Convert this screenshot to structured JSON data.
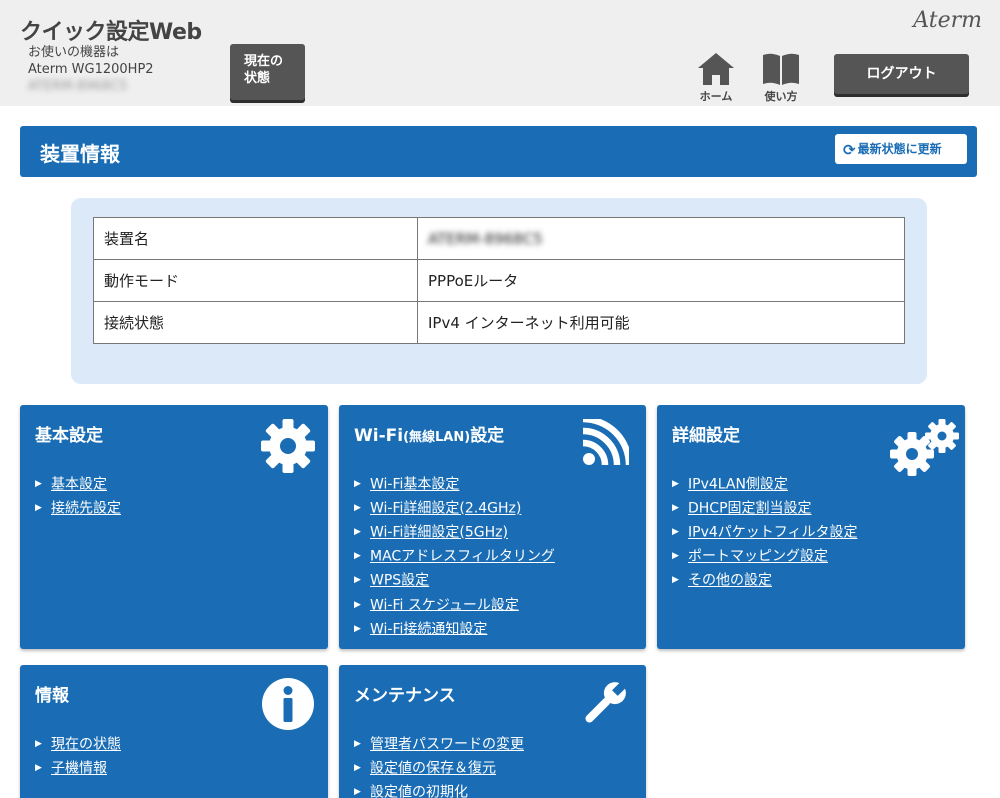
{
  "header": {
    "app_title": "クイック設定Web",
    "device_label": "お使いの機器は",
    "device_model": "Aterm WG1200HP2",
    "device_id": "ATERM-8968C5",
    "status_button": [
      "現在の",
      "状態"
    ],
    "brand": "Aterm",
    "home_label": "ホーム",
    "guide_label": "使い方",
    "logout_label": "ログアウト"
  },
  "device_info": {
    "title": "装置情報",
    "refresh_label": "最新状態に更新",
    "rows": [
      {
        "key": "装置名",
        "value": "ATERM-8968C5"
      },
      {
        "key": "動作モード",
        "value": "PPPoEルータ"
      },
      {
        "key": "接続状態",
        "value": "IPv4 インターネット利用可能"
      }
    ]
  },
  "tiles": {
    "basic": {
      "title": "基本設定",
      "icon": "gear-icon",
      "links": [
        "基本設定",
        "接続先設定"
      ]
    },
    "wifi": {
      "title": "Wi-Fi",
      "title_small": "(無線LAN)",
      "title_suffix": "設定",
      "icon": "wifi-icon",
      "links": [
        "Wi-Fi基本設定",
        "Wi-Fi詳細設定(2.4GHz)",
        "Wi-Fi詳細設定(5GHz)",
        "MACアドレスフィルタリング",
        "WPS設定",
        "Wi-Fi スケジュール設定",
        "Wi-Fi接続通知設定"
      ]
    },
    "advanced": {
      "title": "詳細設定",
      "icon": "gears-icon",
      "links": [
        "IPv4LAN側設定",
        "DHCP固定割当設定",
        "IPv4パケットフィルタ設定",
        "ポートマッピング設定",
        "その他の設定"
      ]
    },
    "info": {
      "title": "情報",
      "icon": "info-icon",
      "links": [
        "現在の状態",
        "子機情報"
      ]
    },
    "maintenance": {
      "title": "メンテナンス",
      "icon": "wrench-icon",
      "links": [
        "管理者パスワードの変更",
        "設定値の保存＆復元",
        "設定値の初期化"
      ]
    }
  },
  "colors": {
    "primary_blue": "#1a6db5",
    "panel_bg": "#dbe9f8",
    "header_bg": "#efefef",
    "dark_button": "#555555"
  }
}
